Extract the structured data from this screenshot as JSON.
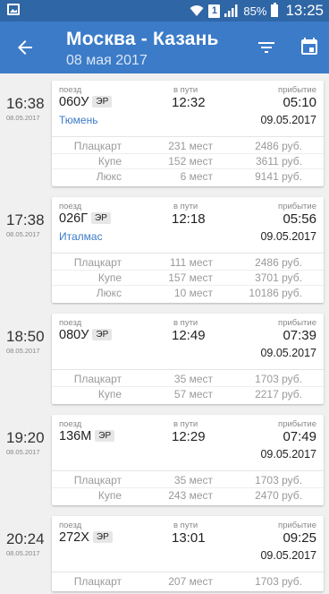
{
  "status_bar": {
    "battery": "85%",
    "time": "13:25",
    "sim": "1"
  },
  "app_bar": {
    "title": "Москва - Казань",
    "subtitle": "08 мая 2017"
  },
  "labels": {
    "train": "поезд",
    "duration": "в пути",
    "arrival": "прибытие"
  },
  "trains": [
    {
      "dep_time": "16:38",
      "dep_date": "08.05.2017",
      "number": "060У",
      "badge": "ЭР",
      "brand": "Тюмень",
      "duration": "12:32",
      "arr_time": "05:10",
      "arr_date": "09.05.2017",
      "fares": [
        {
          "class": "Плацкарт",
          "seats": "231 мест",
          "price": "2486 руб."
        },
        {
          "class": "Купе",
          "seats": "152 мест",
          "price": "3611 руб."
        },
        {
          "class": "Люкс",
          "seats": "6 мест",
          "price": "9141 руб."
        }
      ]
    },
    {
      "dep_time": "17:38",
      "dep_date": "08.05.2017",
      "number": "026Г",
      "badge": "ЭР",
      "brand": "Италмас",
      "duration": "12:18",
      "arr_time": "05:56",
      "arr_date": "09.05.2017",
      "fares": [
        {
          "class": "Плацкарт",
          "seats": "111 мест",
          "price": "2486 руб."
        },
        {
          "class": "Купе",
          "seats": "157 мест",
          "price": "3701 руб."
        },
        {
          "class": "Люкс",
          "seats": "10 мест",
          "price": "10186 руб."
        }
      ]
    },
    {
      "dep_time": "18:50",
      "dep_date": "08.05.2017",
      "number": "080У",
      "badge": "ЭР",
      "brand": "",
      "duration": "12:49",
      "arr_time": "07:39",
      "arr_date": "09.05.2017",
      "fares": [
        {
          "class": "Плацкарт",
          "seats": "35 мест",
          "price": "1703 руб."
        },
        {
          "class": "Купе",
          "seats": "57 мест",
          "price": "2217 руб."
        }
      ]
    },
    {
      "dep_time": "19:20",
      "dep_date": "08.05.2017",
      "number": "136М",
      "badge": "ЭР",
      "brand": "",
      "duration": "12:29",
      "arr_time": "07:49",
      "arr_date": "09.05.2017",
      "fares": [
        {
          "class": "Плацкарт",
          "seats": "35 мест",
          "price": "1703 руб."
        },
        {
          "class": "Купе",
          "seats": "243 мест",
          "price": "2470 руб."
        }
      ]
    },
    {
      "dep_time": "20:24",
      "dep_date": "08.05.2017",
      "number": "272Х",
      "badge": "ЭР",
      "brand": "",
      "duration": "13:01",
      "arr_time": "09:25",
      "arr_date": "09.05.2017",
      "fares": [
        {
          "class": "Плацкарт",
          "seats": "207 мест",
          "price": "1703 руб."
        }
      ]
    }
  ]
}
